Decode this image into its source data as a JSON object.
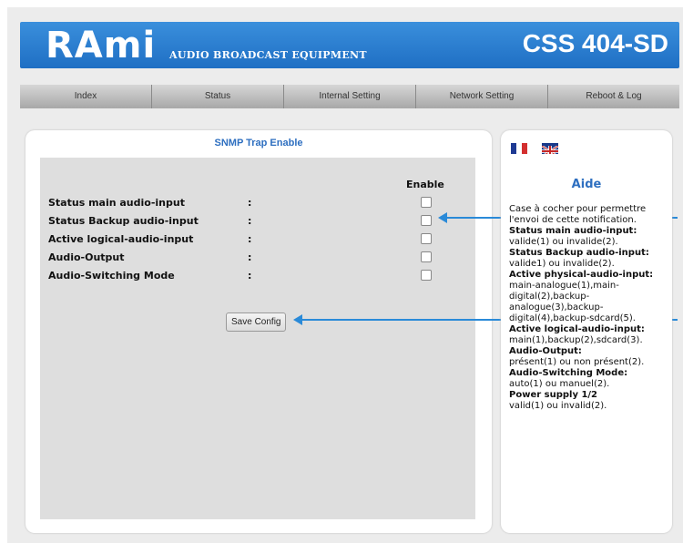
{
  "header": {
    "logo": "RAmi",
    "tagline": "AUDIO BROADCAST EQUIPMENT",
    "model": "CSS 404-SD"
  },
  "nav": [
    "Index",
    "Status",
    "Internal Setting",
    "Network Setting",
    "Reboot & Log"
  ],
  "main": {
    "title": "SNMP Trap Enable",
    "enable_header": "Enable",
    "rows": [
      {
        "label": "Status main audio-input",
        "sep": ":",
        "checked": false
      },
      {
        "label": "Status Backup audio-input",
        "sep": ":",
        "checked": false
      },
      {
        "label": "Active logical-audio-input",
        "sep": ":",
        "checked": false
      },
      {
        "label": "Audio-Output",
        "sep": ":",
        "checked": false
      },
      {
        "label": "Audio-Switching Mode",
        "sep": ":",
        "checked": false
      }
    ],
    "save_label": "Save Config"
  },
  "help": {
    "title": "Aide",
    "intro": "Case à cocher pour permettre l'envoi de cette notification.",
    "items": [
      {
        "h": "Status main audio-input:",
        "t": "valide(1) ou invalide(2)."
      },
      {
        "h": "Status Backup audio-input:",
        "t": "valide1) ou invalide(2)."
      },
      {
        "h": "Active physical-audio-input:",
        "t": "main-analogue(1),main-digital(2),backup-analogue(3),backup-digital(4),backup-sdcard(5)."
      },
      {
        "h": "Active logical-audio-input:",
        "t": "main(1),backup(2),sdcard(3)."
      },
      {
        "h": "Audio-Output:",
        "t": "présent(1) ou non présent(2)."
      },
      {
        "h": "Audio-Switching Mode:",
        "t": "auto(1) ou manuel(2)."
      },
      {
        "h": "Power supply 1/2",
        "t": "valid(1) ou invalid(2)."
      }
    ]
  },
  "colors": {
    "header_blue": "#1f6fc4",
    "title_blue": "#2e6fc0",
    "arrow_blue": "#2a8ad8"
  }
}
